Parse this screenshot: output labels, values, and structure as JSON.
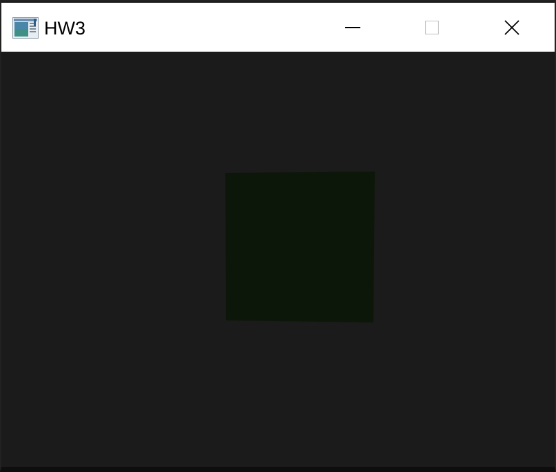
{
  "window": {
    "title": "HW3",
    "app_icon": "application-window-icon",
    "controls": {
      "minimize": "minimize-icon",
      "maximize": "maximize-icon",
      "close": "close-icon"
    }
  },
  "scene": {
    "background_color": "#1b1b1b",
    "square_color": "#0d1709"
  }
}
